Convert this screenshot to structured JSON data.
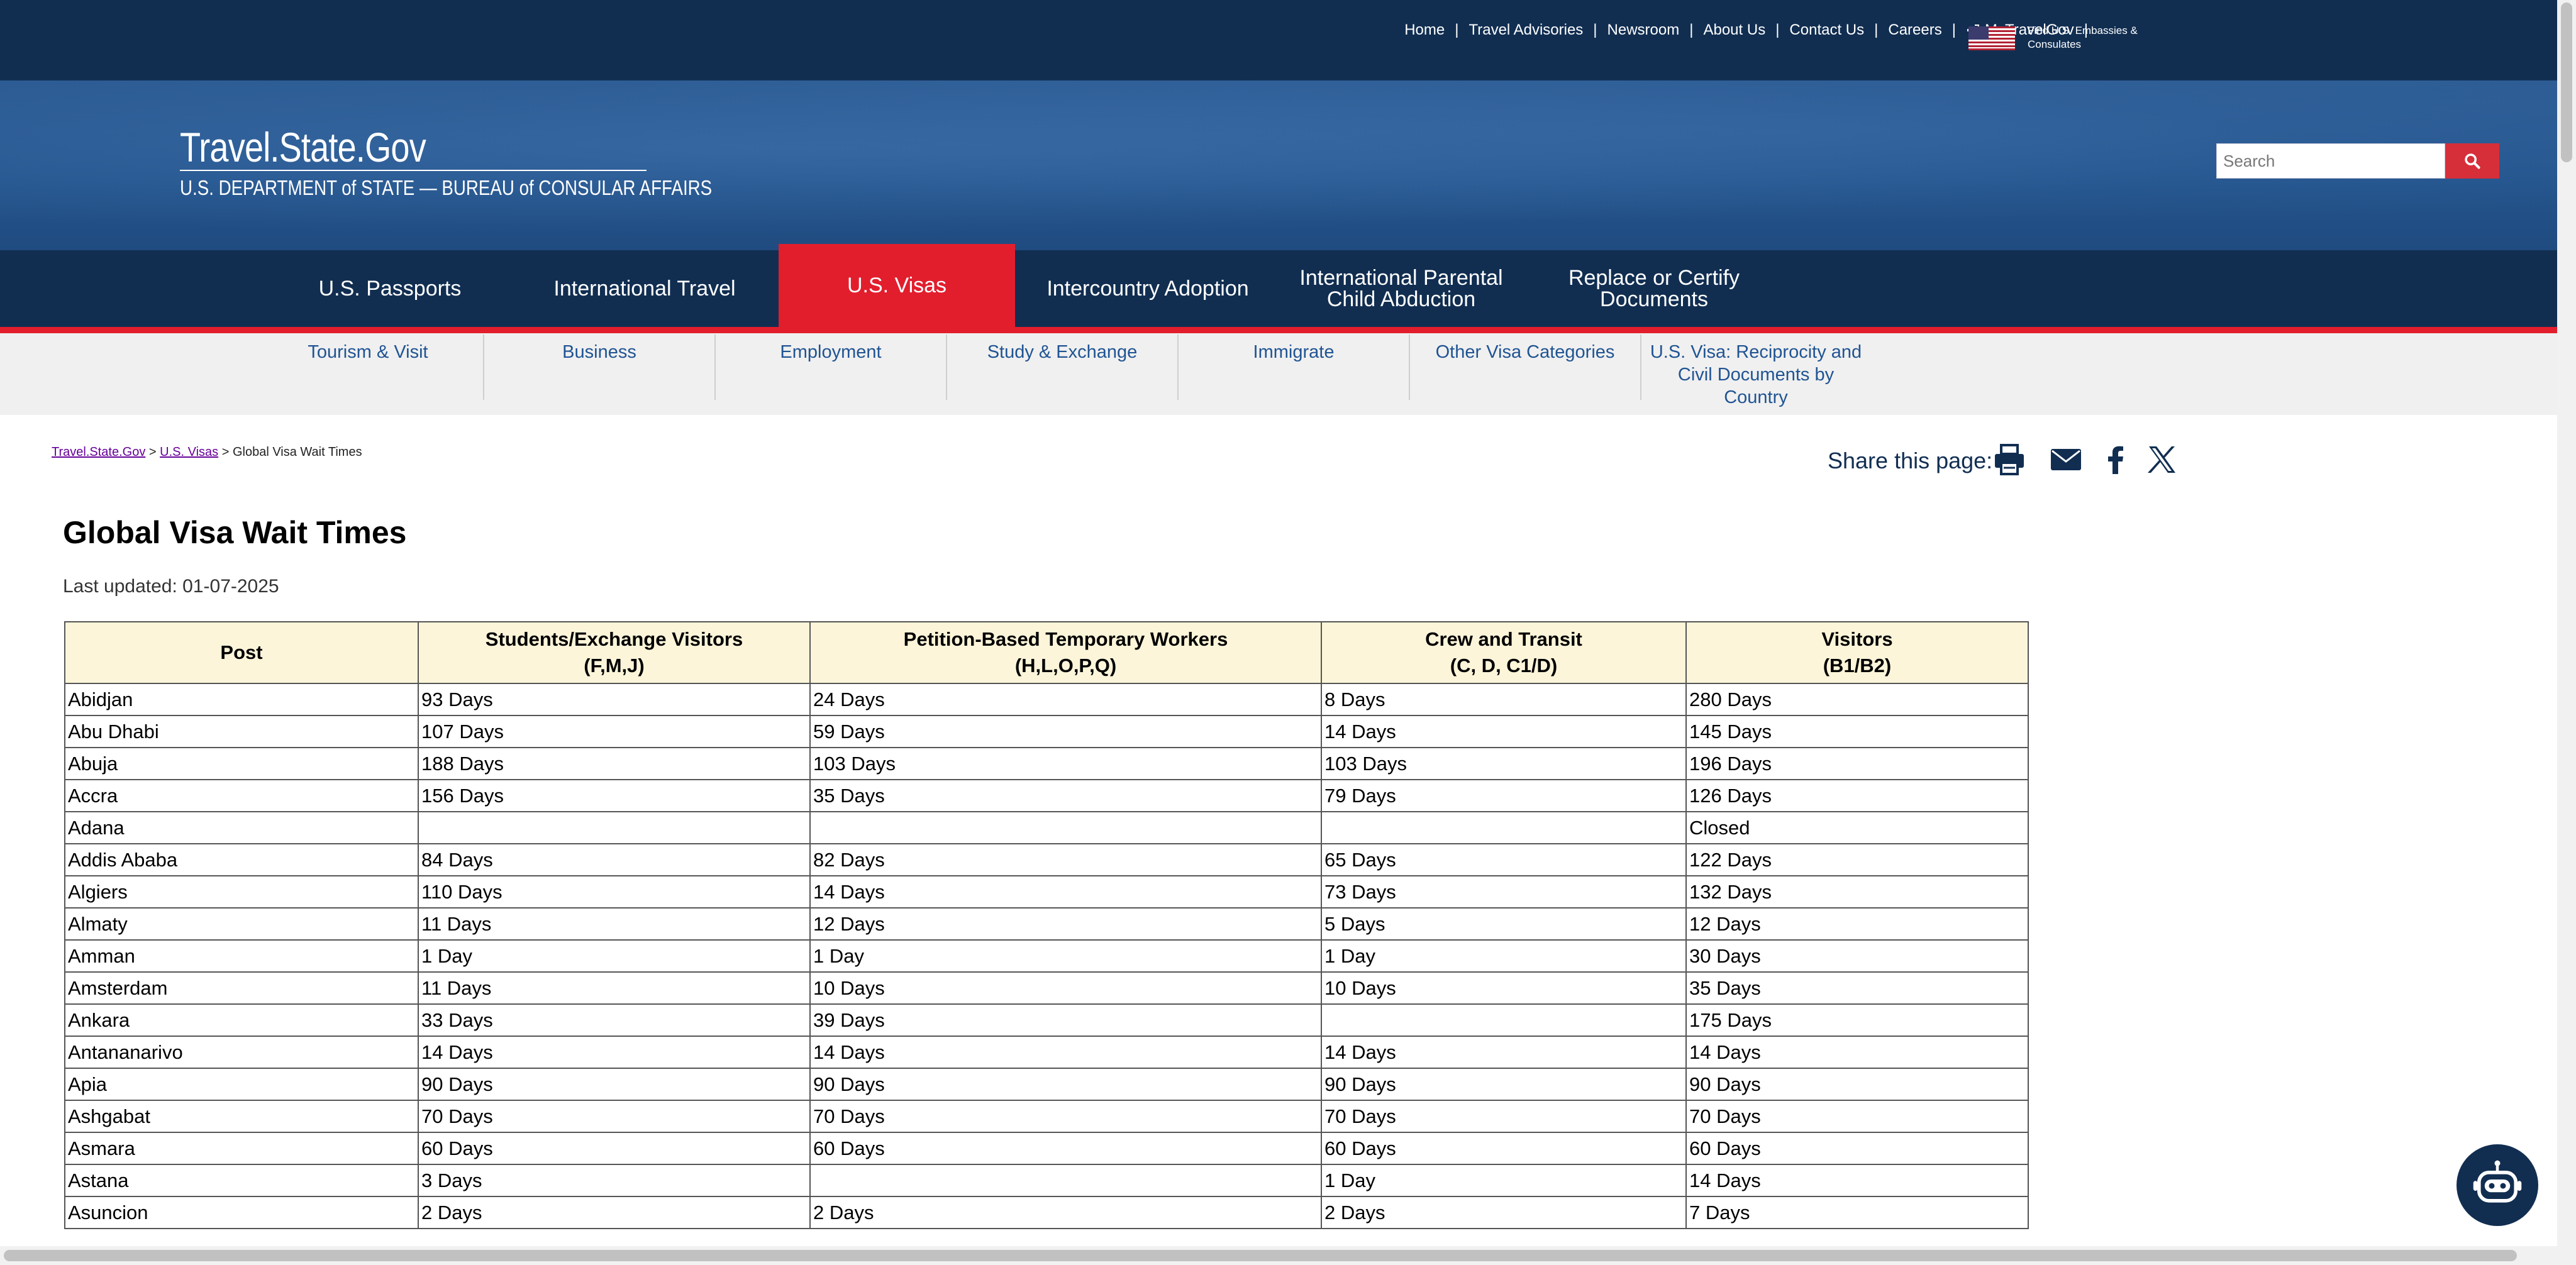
{
  "utility_nav": {
    "items": [
      "Home",
      "Travel Advisories",
      "Newsroom",
      "About Us",
      "Contact Us",
      "Careers"
    ],
    "signin": "MyTravelGov",
    "embassies": "Find U.S. Embassies & Consulates"
  },
  "site": {
    "title": "Travel.State.Gov",
    "subtitle": "U.S. DEPARTMENT of STATE — BUREAU of CONSULAR AFFAIRS"
  },
  "search": {
    "placeholder": "Search"
  },
  "main_nav": [
    "U.S. Passports",
    "International Travel",
    "U.S. Visas",
    "Intercountry Adoption",
    "International Parental Child Abduction",
    "Replace or Certify Documents"
  ],
  "sub_nav": [
    "Tourism & Visit",
    "Business",
    "Employment",
    "Study & Exchange",
    "Immigrate",
    "Other Visa Categories",
    "U.S. Visa: Reciprocity and Civil Documents by Country"
  ],
  "breadcrumb": {
    "home": "Travel.State.Gov",
    "section": "U.S. Visas",
    "current": "Global Visa Wait Times"
  },
  "share": {
    "label": "Share this page:"
  },
  "page": {
    "title": "Global Visa Wait Times",
    "updated": "Last updated: 01-07-2025"
  },
  "table": {
    "headers": [
      {
        "line1": "Post",
        "line2": ""
      },
      {
        "line1": "Students/Exchange Visitors",
        "line2": "(F,M,J)"
      },
      {
        "line1": "Petition-Based Temporary Workers",
        "line2": "(H,L,O,P,Q)"
      },
      {
        "line1": "Crew and Transit",
        "line2": "(C, D, C1/D)"
      },
      {
        "line1": "Visitors",
        "line2": "(B1/B2)"
      }
    ],
    "rows": [
      [
        "Abidjan",
        "93 Days",
        "24 Days",
        "8 Days",
        "280 Days"
      ],
      [
        "Abu Dhabi",
        "107 Days",
        "59 Days",
        "14 Days",
        "145 Days"
      ],
      [
        "Abuja",
        "188 Days",
        "103 Days",
        "103 Days",
        "196 Days"
      ],
      [
        "Accra",
        "156 Days",
        "35 Days",
        "79 Days",
        "126 Days"
      ],
      [
        "Adana",
        "",
        "",
        "",
        "Closed"
      ],
      [
        "Addis Ababa",
        "84 Days",
        "82 Days",
        "65 Days",
        "122 Days"
      ],
      [
        "Algiers",
        "110 Days",
        "14 Days",
        "73 Days",
        "132 Days"
      ],
      [
        "Almaty",
        "11 Days",
        "12 Days",
        "5 Days",
        "12 Days"
      ],
      [
        "Amman",
        "1 Day",
        "1 Day",
        "1 Day",
        "30 Days"
      ],
      [
        "Amsterdam",
        "11 Days",
        "10 Days",
        "10 Days",
        "35 Days"
      ],
      [
        "Ankara",
        "33 Days",
        "39 Days",
        "",
        "175 Days"
      ],
      [
        "Antananarivo",
        "14 Days",
        "14 Days",
        "14 Days",
        "14 Days"
      ],
      [
        "Apia",
        "90 Days",
        "90 Days",
        "90 Days",
        "90 Days"
      ],
      [
        "Ashgabat",
        "70 Days",
        "70 Days",
        "70 Days",
        "70 Days"
      ],
      [
        "Asmara",
        "60 Days",
        "60 Days",
        "60 Days",
        "60 Days"
      ],
      [
        "Astana",
        "3 Days",
        "",
        "1 Day",
        "14 Days"
      ],
      [
        "Asuncion",
        "2 Days",
        "2 Days",
        "2 Days",
        "7 Days"
      ]
    ]
  },
  "colors": {
    "navy": "#112e51",
    "red": "#e21e2d",
    "header_fill": "#fdf5d9",
    "link": "#205493"
  }
}
